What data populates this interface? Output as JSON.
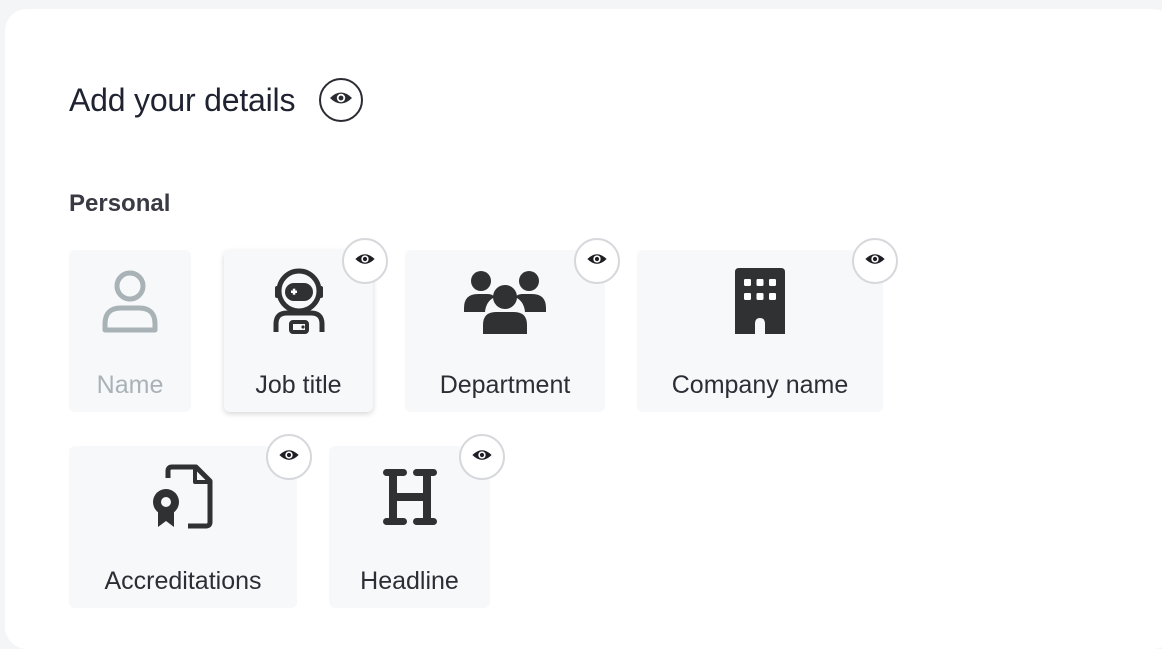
{
  "header": {
    "title": "Add your details",
    "visibility_icon": "eye-icon"
  },
  "section": {
    "label": "Personal"
  },
  "tiles": [
    {
      "label": "Name",
      "icon": "user-icon",
      "state": "disabled"
    },
    {
      "label": "Job title",
      "icon": "astronaut-icon",
      "state": "selected"
    },
    {
      "label": "Department",
      "icon": "users-group-icon",
      "state": "default"
    },
    {
      "label": "Company name",
      "icon": "building-icon",
      "state": "default"
    },
    {
      "label": "Accreditations",
      "icon": "certificate-file-icon",
      "state": "default"
    },
    {
      "label": "Headline",
      "icon": "heading-icon",
      "state": "default"
    }
  ],
  "colors": {
    "icon_dark": "#2f3133",
    "icon_disabled": "#a9b2b6",
    "tile_bg": "#f7f8fa"
  }
}
